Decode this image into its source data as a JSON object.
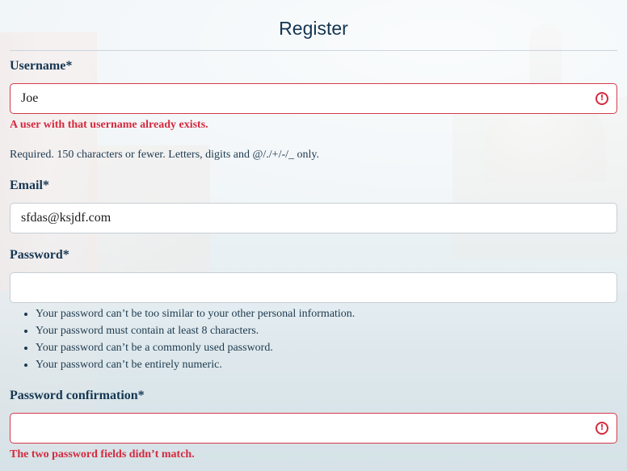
{
  "form": {
    "title": "Register",
    "username": {
      "label": "Username*",
      "value": "Joe",
      "error": "A user with that username already exists.",
      "help": "Required. 150 characters or fewer. Letters, digits and @/./+/-/_ only."
    },
    "email": {
      "label": "Email*",
      "value": "sfdas@ksjdf.com"
    },
    "password": {
      "label": "Password*",
      "value": "",
      "rules": [
        "Your password can’t be too similar to your other personal information.",
        "Your password must contain at least 8 characters.",
        "Your password can’t be a commonly used password.",
        "Your password can’t be entirely numeric."
      ]
    },
    "password_confirmation": {
      "label": "Password confirmation*",
      "value": "",
      "error": "The two password fields didn’t match."
    }
  },
  "icons": {
    "error": "exclamation-circle-icon",
    "error_color": "#d6293e"
  }
}
